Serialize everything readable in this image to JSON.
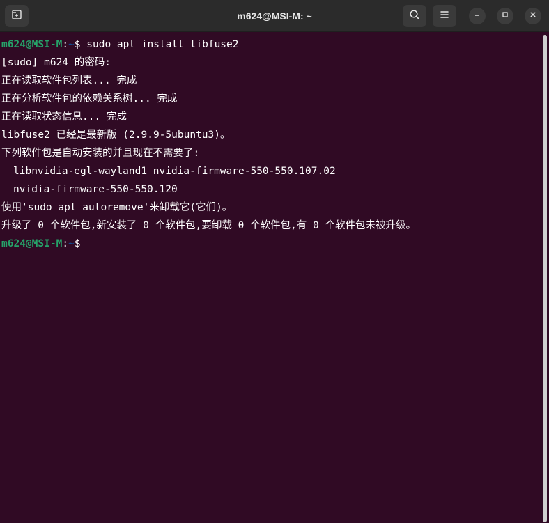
{
  "window": {
    "title": "m624@MSI-M: ~"
  },
  "header": {
    "new_tab_icon": "new-tab-icon",
    "search_icon": "search-icon",
    "menu_icon": "hamburger-menu-icon",
    "minimize_icon": "minimize-icon",
    "maximize_icon": "maximize-icon",
    "close_icon": "close-icon"
  },
  "terminal": {
    "colors": {
      "background": "#300a24",
      "user": "#26a269",
      "path": "#12488b",
      "text": "#ffffff"
    },
    "prompt": {
      "user_host": "m624@MSI-M",
      "separator": ":",
      "path": "~",
      "symbol": "$ "
    },
    "command": "sudo apt install libfuse2",
    "output": [
      "[sudo] m624 的密码:",
      "正在读取软件包列表... 完成",
      "正在分析软件包的依赖关系树... 完成",
      "正在读取状态信息... 完成",
      "libfuse2 已经是最新版 (2.9.9-5ubuntu3)。",
      "下列软件包是自动安装的并且现在不需要了:",
      "libnvidia-egl-wayland1 nvidia-firmware-550-550.107.02",
      "nvidia-firmware-550-550.120",
      "使用'sudo apt autoremove'来卸载它(它们)。",
      "升级了 0 个软件包,新安装了 0 个软件包,要卸载 0 个软件包,有 0 个软件包未被升级。"
    ]
  }
}
